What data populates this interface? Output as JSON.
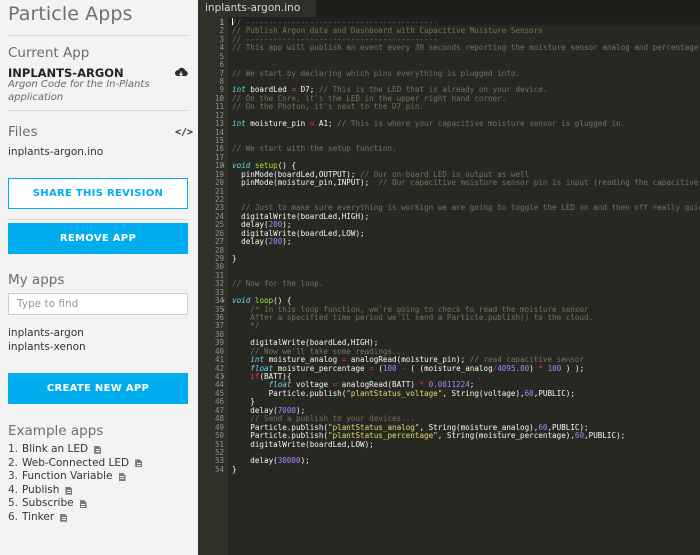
{
  "sidebar": {
    "title": "Particle Apps",
    "current_app": {
      "heading": "Current App",
      "name": "INPLANTS-ARGON",
      "description": "Argon Code for the In-Plants application"
    },
    "files": {
      "heading": "Files",
      "items": [
        "inplants-argon.ino"
      ]
    },
    "buttons": {
      "share": "SHARE THIS REVISION",
      "remove": "REMOVE APP",
      "create": "CREATE NEW APP"
    },
    "my_apps": {
      "heading": "My apps",
      "search_placeholder": "Type to find",
      "items": [
        "inplants-argon",
        "inplants-xenon"
      ]
    },
    "example_apps": {
      "heading": "Example apps",
      "items": [
        {
          "num": "1.",
          "label": "Blink an LED"
        },
        {
          "num": "2.",
          "label": "Web-Connected LED"
        },
        {
          "num": "3.",
          "label": "Function Variable"
        },
        {
          "num": "4.",
          "label": "Publish"
        },
        {
          "num": "5.",
          "label": "Subscribe"
        },
        {
          "num": "6.",
          "label": "Tinker"
        }
      ]
    },
    "icons": [
      "cloud-download-icon",
      "code-icon",
      "document-icon"
    ]
  },
  "editor": {
    "tab": "inplants-argon.ino",
    "fold_lines": [
      18,
      34,
      35,
      43
    ],
    "lines": [
      [
        [
          "c",
          "// ------------------------------------------"
        ]
      ],
      [
        [
          "c",
          "// Publish Argon data and Dashboard with Capacitive Moisture Sensors"
        ]
      ],
      [
        [
          "c",
          "// ------------------------------------------"
        ]
      ],
      [
        [
          "c",
          "// This app will publish an event every 30 seconds reporting the moisture sensor analog and percentage"
        ]
      ],
      [],
      [],
      [
        [
          "c",
          "// We start by declaring which pins everything is plugged into."
        ]
      ],
      [],
      [
        [
          "t",
          "int"
        ],
        [
          "p",
          " boardLed "
        ],
        [
          "k",
          "="
        ],
        [
          "p",
          " D7; "
        ],
        [
          "c",
          "// This is the LED that is already on your device."
        ]
      ],
      [
        [
          "c",
          "// On the Core, it's the LED in the upper right hand corner."
        ]
      ],
      [
        [
          "c",
          "// On the Photon, it's next to the D7 pin."
        ]
      ],
      [],
      [
        [
          "t",
          "int"
        ],
        [
          "p",
          " moisture_pin "
        ],
        [
          "k",
          "="
        ],
        [
          "p",
          " A1; "
        ],
        [
          "c",
          "// This is where your capacitive moisture sensor is plugged in."
        ]
      ],
      [],
      [],
      [
        [
          "c",
          "// We start with the setup function."
        ]
      ],
      [],
      [
        [
          "t",
          "void"
        ],
        [
          "p",
          " "
        ],
        [
          "f",
          "setup"
        ],
        [
          "p",
          "() {"
        ]
      ],
      [
        [
          "p",
          "  pinMode(boardLed,OUTPUT); "
        ],
        [
          "c",
          "// Our on-board LED is output as well"
        ]
      ],
      [
        [
          "p",
          "  pinMode(moisture_pin,INPUT);  "
        ],
        [
          "c",
          "// Our capacitive moisture sensor pin is input (reading the capacitive moisture sensor)"
        ]
      ],
      [],
      [],
      [
        [
          "c",
          "  // Just to make sure everything is workign we are going to toggle the LED on and then off really quickly"
        ]
      ],
      [
        [
          "p",
          "  digitalWrite(boardLed,HIGH);"
        ]
      ],
      [
        [
          "p",
          "  delay("
        ],
        [
          "n",
          "200"
        ],
        [
          "p",
          ");"
        ]
      ],
      [
        [
          "p",
          "  digitalWrite(boardLed,LOW);"
        ]
      ],
      [
        [
          "p",
          "  delay("
        ],
        [
          "n",
          "200"
        ],
        [
          "p",
          ");"
        ]
      ],
      [],
      [
        [
          "p",
          "}"
        ]
      ],
      [],
      [],
      [
        [
          "c",
          "// Now for the loop."
        ]
      ],
      [],
      [
        [
          "t",
          "void"
        ],
        [
          "p",
          " "
        ],
        [
          "f",
          "loop"
        ],
        [
          "p",
          "() {"
        ]
      ],
      [
        [
          "c",
          "    /* In this loop function, we're going to check to read the moisture sensor"
        ]
      ],
      [
        [
          "c",
          "    After a specified time period we'll send a Particle.publish() to the cloud."
        ]
      ],
      [
        [
          "c",
          "    */"
        ]
      ],
      [],
      [
        [
          "p",
          "    digitalWrite(boardLed,HIGH);"
        ]
      ],
      [
        [
          "c",
          "    // Now we'll take some readings..."
        ]
      ],
      [
        [
          "p",
          "    "
        ],
        [
          "t",
          "int"
        ],
        [
          "p",
          " moisture_analog "
        ],
        [
          "k",
          "="
        ],
        [
          "p",
          " analogRead(moisture_pin); "
        ],
        [
          "c",
          "// read capacitive sensor"
        ]
      ],
      [
        [
          "p",
          "    "
        ],
        [
          "t",
          "float"
        ],
        [
          "p",
          " moisture_percentage "
        ],
        [
          "k",
          "="
        ],
        [
          "p",
          " ("
        ],
        [
          "n",
          "100"
        ],
        [
          "p",
          " "
        ],
        [
          "k",
          "-"
        ],
        [
          "p",
          " ( (moisture_analog"
        ],
        [
          "k",
          "/"
        ],
        [
          "n",
          "4095.00"
        ],
        [
          "p",
          ") "
        ],
        [
          "k",
          "*"
        ],
        [
          "p",
          " "
        ],
        [
          "n",
          "100"
        ],
        [
          "p",
          " ) );"
        ]
      ],
      [
        [
          "p",
          "    "
        ],
        [
          "k",
          "if"
        ],
        [
          "p",
          "(BATT){"
        ]
      ],
      [
        [
          "p",
          "        "
        ],
        [
          "t",
          "float"
        ],
        [
          "p",
          " voltage "
        ],
        [
          "k",
          "="
        ],
        [
          "p",
          " analogRead(BATT) "
        ],
        [
          "k",
          "*"
        ],
        [
          "p",
          " "
        ],
        [
          "n",
          "0.0011224"
        ],
        [
          "p",
          ";"
        ]
      ],
      [
        [
          "p",
          "        Particle.publish("
        ],
        [
          "s",
          "\"plantStatus_voltage\""
        ],
        [
          "p",
          ", String(voltage),"
        ],
        [
          "n",
          "60"
        ],
        [
          "p",
          ",PUBLIC);"
        ]
      ],
      [
        [
          "p",
          "    }"
        ]
      ],
      [
        [
          "p",
          "    delay("
        ],
        [
          "n",
          "7000"
        ],
        [
          "p",
          ");"
        ]
      ],
      [
        [
          "c",
          "    // Send a publish to your devices..."
        ]
      ],
      [
        [
          "p",
          "    Particle.publish("
        ],
        [
          "s",
          "\"plantStatus_analog\""
        ],
        [
          "p",
          ", String(moisture_analog),"
        ],
        [
          "n",
          "60"
        ],
        [
          "p",
          ",PUBLIC);"
        ]
      ],
      [
        [
          "p",
          "    Particle.publish("
        ],
        [
          "s",
          "\"plantStatus_percentage\""
        ],
        [
          "p",
          ", String(moisture_percentage),"
        ],
        [
          "n",
          "60"
        ],
        [
          "p",
          ",PUBLIC);"
        ]
      ],
      [
        [
          "p",
          "    digitalWrite(boardLed,LOW);"
        ]
      ],
      [],
      [
        [
          "p",
          "    delay("
        ],
        [
          "n",
          "30000"
        ],
        [
          "p",
          ");"
        ]
      ],
      [
        [
          "p",
          "}"
        ]
      ]
    ]
  },
  "colors": {
    "accent": "#00aeef",
    "sidebar_bg": "#f3f3f3",
    "editor_bg": "#272822",
    "gutter_bg": "#2f3129",
    "comment": "#75715e",
    "keyword": "#f92672",
    "type": "#66d9ef",
    "number": "#ae81ff",
    "string": "#e6db74",
    "function": "#a6e22e"
  }
}
